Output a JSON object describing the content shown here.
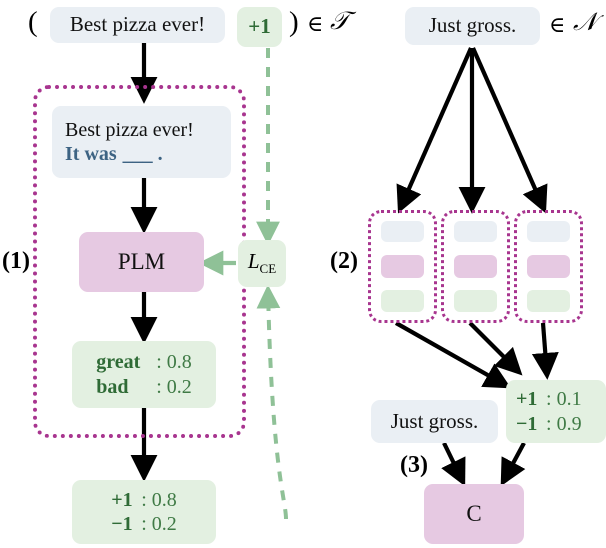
{
  "figure": {
    "title": "Prompt-based few-shot learning and distillation pipeline",
    "colors": {
      "blue_box": "#eaeff4",
      "pink_box": "#e6c9e2",
      "green_box": "#e3f0e1",
      "dotted_purple": "#a8358f",
      "green_arrow": "#8fc197",
      "black_arrow": "#000000",
      "blue_text": "#3d6383",
      "green_text": "#3f7a45"
    }
  },
  "top_left": {
    "open_paren": "(",
    "sentence": "Best pizza ever!",
    "label": "+1",
    "close_paren": ")",
    "member_symbol": "∈",
    "set_name": "𝒯"
  },
  "top_right": {
    "sentence": "Just gross.",
    "member_symbol": "∈",
    "set_name": "𝒩"
  },
  "step_labels": {
    "one": "(1)",
    "two": "(2)",
    "three": "(3)"
  },
  "step1": {
    "prompt_box": {
      "line1": "Best pizza ever!",
      "line2_prefix": "It was",
      "line2_blank": "___",
      "line2_period": "."
    },
    "model_box": {
      "label": "PLM"
    },
    "loss_box": {
      "label": "L",
      "subscript": "CE"
    },
    "verbalizer_box": {
      "rows": [
        {
          "token": "great",
          "sep": ":",
          "value": "0.8"
        },
        {
          "token": "bad",
          "sep": ":",
          "value": "0.2"
        }
      ]
    },
    "label_dist_box": {
      "rows": [
        {
          "token": "+1",
          "sep": ":",
          "value": "0.8"
        },
        {
          "token": "−1",
          "sep": ":",
          "value": "0.2"
        }
      ]
    }
  },
  "step2": {
    "ensemble_members": [
      {
        "tiles": [
          "blue",
          "pink",
          "green"
        ]
      },
      {
        "tiles": [
          "blue",
          "pink",
          "green"
        ]
      },
      {
        "tiles": [
          "blue",
          "pink",
          "green"
        ]
      }
    ],
    "soft_label_box": {
      "rows": [
        {
          "token": "+1",
          "sep": ":",
          "value": "0.1"
        },
        {
          "token": "−1",
          "sep": ":",
          "value": "0.9"
        }
      ]
    }
  },
  "step3": {
    "input_box": {
      "sentence": "Just gross."
    },
    "classifier_box": {
      "label": "C"
    }
  }
}
